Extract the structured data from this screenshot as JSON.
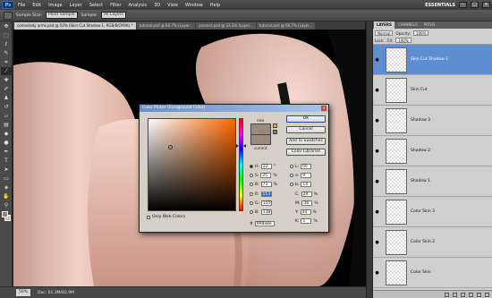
{
  "app": {
    "logo": "Ps",
    "menu": [
      "File",
      "Edit",
      "Image",
      "Layer",
      "Select",
      "Filter",
      "Analysis",
      "3D",
      "View",
      "Window",
      "Help"
    ],
    "workspace": "ESSENTIALS",
    "window_buttons": [
      "–",
      "□",
      "×"
    ]
  },
  "options_bar": {
    "sample_size_label": "Sample Size:",
    "sample_size_value": "Point Sample",
    "sample_label": "Sample:",
    "sample_value": "All Layers"
  },
  "tabs": [
    {
      "label": "comoslady arms.psd @ 50% (Skin Cut Shadow 1, RGB/8/CMYK) *",
      "active": true
    },
    {
      "label": "tutorial.psd @ 66.7% (Layer...",
      "active": false
    },
    {
      "label": "process.psd @ 33.3% (Layer...",
      "active": false
    },
    {
      "label": "tutorial.psd @ 66.7% (Layer...",
      "active": false
    }
  ],
  "status": {
    "zoom": "50%",
    "doc": "Doc: 61.3M/83.9M"
  },
  "color_picker": {
    "title": "Color Picker (Foreground Color)",
    "new_label": "new",
    "current_label": "current",
    "new_color": "#998a7e",
    "current_color": "#9b8a80",
    "buttons": {
      "ok": "OK",
      "cancel": "Cancel",
      "add_to_swatches": "Add To Swatches",
      "color_libraries": "Color Libraries"
    },
    "fields_left": [
      {
        "label": "H:",
        "value": "22",
        "unit": "°",
        "checked": true
      },
      {
        "label": "S:",
        "value": "25",
        "unit": "%",
        "checked": false
      },
      {
        "label": "B:",
        "value": "73",
        "unit": "%",
        "checked": false
      },
      {
        "label": "R:",
        "value": "153",
        "unit": "",
        "checked": false
      },
      {
        "label": "G:",
        "value": "155",
        "unit": "",
        "checked": false
      },
      {
        "label": "B:",
        "value": "138",
        "unit": "",
        "checked": false
      }
    ],
    "fields_right": [
      {
        "label": "L:",
        "value": "66",
        "unit": ""
      },
      {
        "label": "a:",
        "value": "9",
        "unit": ""
      },
      {
        "label": "b:",
        "value": "14",
        "unit": ""
      },
      {
        "label": "C:",
        "value": "29",
        "unit": "%"
      },
      {
        "label": "M:",
        "value": "38",
        "unit": "%"
      },
      {
        "label": "Y:",
        "value": "44",
        "unit": "%"
      },
      {
        "label": "K:",
        "value": "1",
        "unit": "%"
      }
    ],
    "only_web_colors": "Only Web Colors",
    "hex_label": "#",
    "hex_value": "998a8e"
  },
  "layers_panel": {
    "tabs": [
      "LAYERS",
      "CHANNELS",
      "PATHS"
    ],
    "blend_mode": "Normal",
    "opacity_label": "Opacity:",
    "opacity_value": "100%",
    "lock_label": "Lock:",
    "fill_label": "Fill:",
    "fill_value": "100%",
    "layers": [
      {
        "name": "Skin Cut Shadow 1",
        "selected": true
      },
      {
        "name": "Skin Cut",
        "selected": false
      },
      {
        "name": "Shadow 3",
        "selected": false
      },
      {
        "name": "Shadow 2",
        "selected": false
      },
      {
        "name": "Shadow 1",
        "selected": false
      },
      {
        "name": "Color Skin 3",
        "selected": false
      },
      {
        "name": "Color Skin 2",
        "selected": false
      },
      {
        "name": "Color Skin",
        "selected": false
      }
    ]
  }
}
